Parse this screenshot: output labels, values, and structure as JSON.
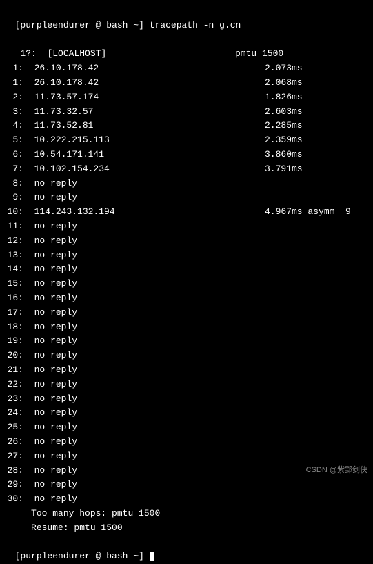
{
  "prompt": {
    "user": "purpleendurer",
    "host_sep": " @ ",
    "shell": "bash",
    "path": "~",
    "command": "tracepath -n g.cn"
  },
  "first_line": {
    "hop": "1?:",
    "host": "[LOCALHOST]",
    "info": "pmtu 1500"
  },
  "hops": [
    {
      "n": "1",
      "host": "26.10.178.42",
      "time": "2.073ms"
    },
    {
      "n": "1",
      "host": "26.10.178.42",
      "time": "2.068ms"
    },
    {
      "n": "2",
      "host": "11.73.57.174",
      "time": "1.826ms"
    },
    {
      "n": "3",
      "host": "11.73.32.57",
      "time": "2.603ms"
    },
    {
      "n": "4",
      "host": "11.73.52.81",
      "time": "2.285ms"
    },
    {
      "n": "5",
      "host": "10.222.215.113",
      "time": "2.359ms"
    },
    {
      "n": "6",
      "host": "10.54.171.141",
      "time": "3.860ms"
    },
    {
      "n": "7",
      "host": "10.102.154.234",
      "time": "3.791ms"
    },
    {
      "n": "8",
      "host": "no reply",
      "time": ""
    },
    {
      "n": "9",
      "host": "no reply",
      "time": ""
    },
    {
      "n": "10",
      "host": "114.243.132.194",
      "time": "4.967ms asymm  9"
    },
    {
      "n": "11",
      "host": "no reply",
      "time": ""
    },
    {
      "n": "12",
      "host": "no reply",
      "time": ""
    },
    {
      "n": "13",
      "host": "no reply",
      "time": ""
    },
    {
      "n": "14",
      "host": "no reply",
      "time": ""
    },
    {
      "n": "15",
      "host": "no reply",
      "time": ""
    },
    {
      "n": "16",
      "host": "no reply",
      "time": ""
    },
    {
      "n": "17",
      "host": "no reply",
      "time": ""
    },
    {
      "n": "18",
      "host": "no reply",
      "time": ""
    },
    {
      "n": "19",
      "host": "no reply",
      "time": ""
    },
    {
      "n": "20",
      "host": "no reply",
      "time": ""
    },
    {
      "n": "21",
      "host": "no reply",
      "time": ""
    },
    {
      "n": "22",
      "host": "no reply",
      "time": ""
    },
    {
      "n": "23",
      "host": "no reply",
      "time": ""
    },
    {
      "n": "24",
      "host": "no reply",
      "time": ""
    },
    {
      "n": "25",
      "host": "no reply",
      "time": ""
    },
    {
      "n": "26",
      "host": "no reply",
      "time": ""
    },
    {
      "n": "27",
      "host": "no reply",
      "time": ""
    },
    {
      "n": "28",
      "host": "no reply",
      "time": ""
    },
    {
      "n": "29",
      "host": "no reply",
      "time": ""
    },
    {
      "n": "30",
      "host": "no reply",
      "time": ""
    }
  ],
  "footer": [
    "Too many hops: pmtu 1500",
    "Resume: pmtu 1500"
  ],
  "watermark": "CSDN @紫郢剑侠"
}
